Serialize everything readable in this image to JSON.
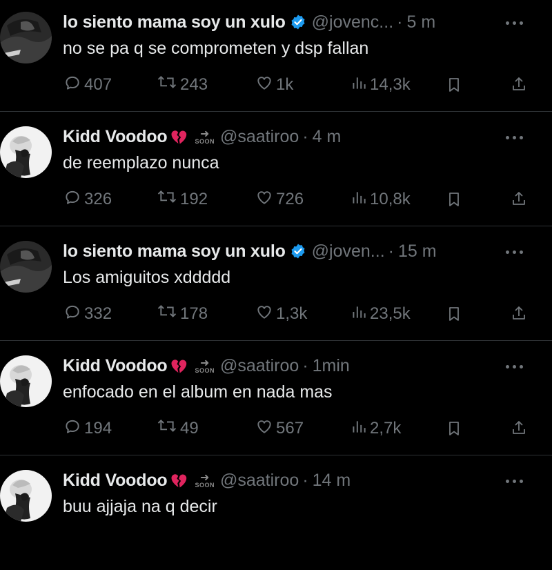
{
  "tweets": [
    {
      "name": "lo siento mama soy un xulo",
      "verified": true,
      "handle": "@jovenc...",
      "time": "5 m",
      "text": "no se pa q se comprometen y dsp fallan",
      "replies": "407",
      "reposts": "243",
      "likes": "1k",
      "views": "14,3k",
      "avatar": "dark-avatar"
    },
    {
      "name": "Kidd Voodoo",
      "emoji": "broken-heart-icon",
      "soon_label": "SOON",
      "handle": "@saatiroo",
      "time": "4 m",
      "text": "de reemplazo nunca",
      "replies": "326",
      "reposts": "192",
      "likes": "726",
      "views": "10,8k",
      "avatar": "white-avatar"
    },
    {
      "name": "lo siento mama soy un xulo",
      "verified": true,
      "handle": "@joven...",
      "time": "15 m",
      "text": "Los amiguitos xddddd",
      "replies": "332",
      "reposts": "178",
      "likes": "1,3k",
      "views": "23,5k",
      "avatar": "dark-avatar"
    },
    {
      "name": "Kidd Voodoo",
      "emoji": "broken-heart-icon",
      "soon_label": "SOON",
      "handle": "@saatiroo",
      "time": "1min",
      "text": "enfocado en el album en nada mas",
      "replies": "194",
      "reposts": "49",
      "likes": "567",
      "views": "2,7k",
      "avatar": "white-avatar"
    },
    {
      "name": "Kidd Voodoo",
      "emoji": "broken-heart-icon",
      "soon_label": "SOON",
      "handle": "@saatiroo",
      "time": "14 m",
      "text": "buu ajjaja na q decir",
      "avatar": "white-avatar"
    }
  ],
  "colors": {
    "background": "#000000",
    "text": "#e7e9ea",
    "muted": "#71767b",
    "verified": "#1d9bf0",
    "broken_heart": "#e0245e"
  }
}
